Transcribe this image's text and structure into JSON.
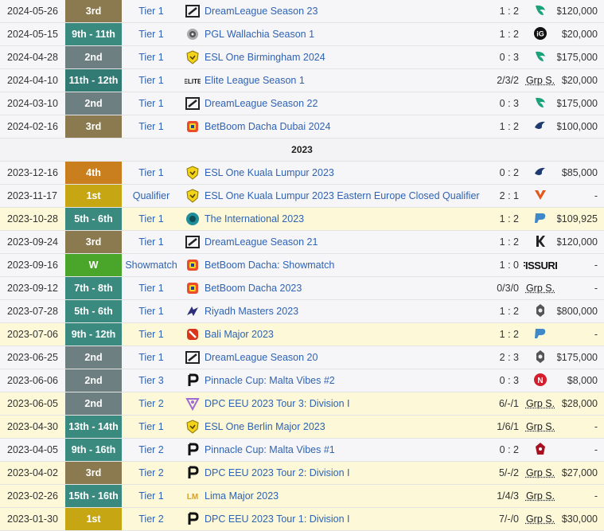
{
  "colors": {
    "third": "#8b7a4f",
    "second": "#6d7f80",
    "ninth_eleventh": "#3b8a80",
    "eleventh": "#327a74",
    "fourth": "#c97f1e",
    "first": "#c6a613",
    "win": "#4aa52b",
    "link": "#2f63b3",
    "highlight": "#fcf8d8"
  },
  "rows": [
    {
      "date": "2024-05-26",
      "place": "3rd",
      "pc": "third",
      "tier": "Tier 1",
      "tlogo": "dreamleague-logo-icon",
      "tournament": "DreamLeague Season 23",
      "score": "1 : 2",
      "opp": "team-falcons-icon",
      "prize": "$120,000",
      "hl": false
    },
    {
      "date": "2024-05-15",
      "place": "9th - 11th",
      "pc": "ninth",
      "tier": "Tier 1",
      "tlogo": "pgl-logo-icon",
      "tournament": "PGL Wallachia Season 1",
      "score": "1 : 2",
      "opp": "team-ig-icon",
      "prize": "$20,000",
      "hl": false
    },
    {
      "date": "2024-04-28",
      "place": "2nd",
      "pc": "second",
      "tier": "Tier 1",
      "tlogo": "esl-one-logo-icon",
      "tournament": "ESL One Birmingham 2024",
      "score": "0 : 3",
      "opp": "team-falcons-icon",
      "prize": "$175,000",
      "hl": false
    },
    {
      "date": "2024-04-10",
      "place": "11th - 12th",
      "pc": "eleventh",
      "tier": "Tier 1",
      "tlogo": "elite-league-logo-icon",
      "tournament": "Elite League Season 1",
      "score": "2/3/2",
      "opp": "grp",
      "prize": "$20,000",
      "hl": false
    },
    {
      "date": "2024-03-10",
      "place": "2nd",
      "pc": "second",
      "tier": "Tier 1",
      "tlogo": "dreamleague-logo-icon",
      "tournament": "DreamLeague Season 22",
      "score": "0 : 3",
      "opp": "team-falcons-icon",
      "prize": "$175,000",
      "hl": false
    },
    {
      "date": "2024-02-16",
      "place": "3rd",
      "pc": "third",
      "tier": "Tier 1",
      "tlogo": "betboom-dacha-logo-icon",
      "tournament": "BetBoom Dacha Dubai 2024",
      "score": "1 : 2",
      "opp": "team-liquid-icon",
      "prize": "$100,000",
      "hl": false
    },
    {
      "year": "2023"
    },
    {
      "date": "2023-12-16",
      "place": "4th",
      "pc": "fourth",
      "tier": "Tier 1",
      "tlogo": "esl-one-logo-icon",
      "tournament": "ESL One Kuala Lumpur 2023",
      "score": "0 : 2",
      "opp": "team-liquid-icon",
      "prize": "$85,000",
      "hl": false
    },
    {
      "date": "2023-11-17",
      "place": "1st",
      "pc": "first",
      "tier": "Qualifier",
      "tlogo": "esl-one-logo-icon",
      "tournament": "ESL One Kuala Lumpur 2023 Eastern Europe Closed Qualifier",
      "score": "2 : 1",
      "opp": "virtus-pro-icon",
      "prize": "-",
      "hl": false
    },
    {
      "date": "2023-10-28",
      "place": "5th - 6th",
      "pc": "ninth",
      "tier": "Tier 1",
      "tlogo": "the-international-logo-icon",
      "tournament": "The International 2023",
      "score": "1 : 2",
      "opp": "team-spirit-icon",
      "prize": "$109,925",
      "hl": true
    },
    {
      "date": "2023-09-24",
      "place": "3rd",
      "pc": "third",
      "tier": "Tier 1",
      "tlogo": "dreamleague-logo-icon",
      "tournament": "DreamLeague Season 21",
      "score": "1 : 2",
      "opp": "team-k-icon",
      "prize": "$120,000",
      "hl": false
    },
    {
      "date": "2023-09-16",
      "place": "W",
      "pc": "win",
      "tier": "Showmatch",
      "tlogo": "betboom-dacha-logo-icon",
      "tournament": "BetBoom Dacha: Showmatch",
      "score": "1 : 0",
      "opp": "fissure",
      "prize": "-",
      "hl": false
    },
    {
      "date": "2023-09-12",
      "place": "7th - 8th",
      "pc": "ninth",
      "tier": "Tier 1",
      "tlogo": "betboom-dacha-logo-icon",
      "tournament": "BetBoom Dacha 2023",
      "score": "0/3/0",
      "opp": "grp",
      "prize": "-",
      "hl": false
    },
    {
      "date": "2023-07-28",
      "place": "5th - 6th",
      "pc": "ninth",
      "tier": "Tier 1",
      "tlogo": "riyadh-masters-logo-icon",
      "tournament": "Riyadh Masters 2023",
      "score": "1 : 2",
      "opp": "gaimin-gladiators-icon",
      "prize": "$800,000",
      "hl": false
    },
    {
      "date": "2023-07-06",
      "place": "9th - 12th",
      "pc": "ninth",
      "tier": "Tier 1",
      "tlogo": "dota2-logo-icon",
      "tournament": "Bali Major 2023",
      "score": "1 : 2",
      "opp": "team-spirit-icon",
      "prize": "-",
      "hl": true
    },
    {
      "date": "2023-06-25",
      "place": "2nd",
      "pc": "second",
      "tier": "Tier 1",
      "tlogo": "dreamleague-logo-icon",
      "tournament": "DreamLeague Season 20",
      "score": "2 : 3",
      "opp": "gaimin-gladiators-icon",
      "prize": "$175,000",
      "hl": false
    },
    {
      "date": "2023-06-06",
      "place": "2nd",
      "pc": "second",
      "tier": "Tier 3",
      "tlogo": "pinnacle-logo-icon",
      "tournament": "Pinnacle Cup: Malta Vibes #2",
      "score": "0 : 3",
      "opp": "n-team-icon",
      "prize": "$8,000",
      "hl": false
    },
    {
      "date": "2023-06-05",
      "place": "2nd",
      "pc": "second",
      "tier": "Tier 2",
      "tlogo": "dpc-logo-icon",
      "tournament": "DPC EEU 2023 Tour 3: Division I",
      "score": "6/-/1",
      "opp": "grp",
      "prize": "$28,000",
      "hl": true
    },
    {
      "date": "2023-04-30",
      "place": "13th - 14th",
      "pc": "ninth",
      "tier": "Tier 1",
      "tlogo": "esl-one-logo-icon",
      "tournament": "ESL One Berlin Major 2023",
      "score": "1/6/1",
      "opp": "grp",
      "prize": "-",
      "hl": true
    },
    {
      "date": "2023-04-05",
      "place": "9th - 16th",
      "pc": "ninth",
      "tier": "Tier 2",
      "tlogo": "pinnacle-logo-icon",
      "tournament": "Pinnacle Cup: Malta Vibes #1",
      "score": "0 : 2",
      "opp": "red-team-icon",
      "prize": "-",
      "hl": false
    },
    {
      "date": "2023-04-02",
      "place": "3rd",
      "pc": "third",
      "tier": "Tier 2",
      "tlogo": "pinnacle-logo-icon",
      "tournament": "DPC EEU 2023 Tour 2: Division I",
      "score": "5/-/2",
      "opp": "grp",
      "prize": "$27,000",
      "hl": true
    },
    {
      "date": "2023-02-26",
      "place": "15th - 16th",
      "pc": "ninth",
      "tier": "Tier 1",
      "tlogo": "lima-major-logo-icon",
      "tournament": "Lima Major 2023",
      "score": "1/4/3",
      "opp": "grp",
      "prize": "-",
      "hl": true
    },
    {
      "date": "2023-01-30",
      "place": "1st",
      "pc": "first",
      "tier": "Tier 2",
      "tlogo": "pinnacle-logo-icon",
      "tournament": "DPC EEU 2023 Tour 1: Division I",
      "score": "7/-/0",
      "opp": "grp",
      "prize": "$30,000",
      "hl": true
    }
  ],
  "labels": {
    "group_stage": "Grp S.",
    "fissure": "FISSURE"
  }
}
